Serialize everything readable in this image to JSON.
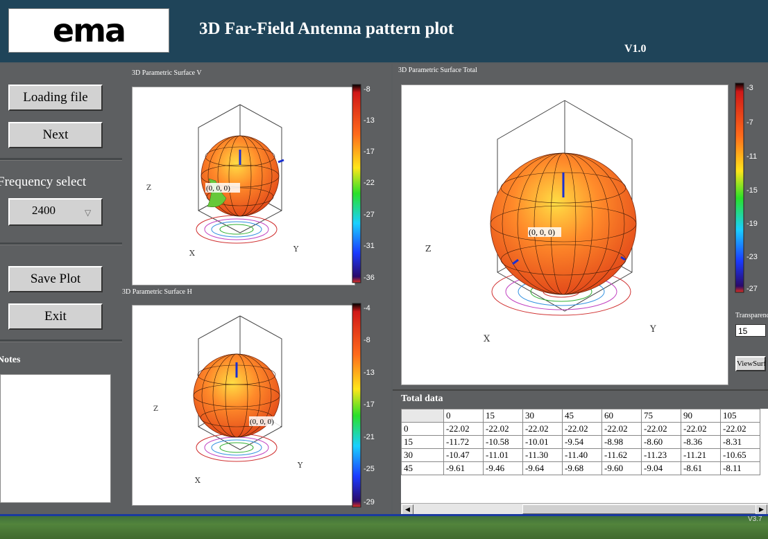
{
  "header": {
    "logo_text": "ema",
    "title": "3D Far-Field Antenna pattern plot",
    "version": "V1.0"
  },
  "left_panel": {
    "loading_button": "Loading file",
    "next_button": "Next",
    "frequency_label": "Frequency select",
    "frequency_value": "2400",
    "save_button": "Save Plot",
    "exit_button": "Exit",
    "notes_label": "Notes"
  },
  "plots": {
    "v": {
      "title": "3D Parametric Surface V",
      "origin_label": "(0, 0, 0)",
      "colorbar_ticks": [
        "-8",
        "-13",
        "-17",
        "-22",
        "-27",
        "-31",
        "-36"
      ]
    },
    "h": {
      "title": "3D Parametric Surface H",
      "origin_label": "(0, 0, 0)",
      "colorbar_ticks": [
        "-4",
        "-8",
        "-13",
        "-17",
        "-21",
        "-25",
        "-29"
      ]
    },
    "total": {
      "title": "3D Parametric Surface Total",
      "origin_label": "(0, 0, 0)",
      "colorbar_ticks": [
        "-3",
        "-7",
        "-11",
        "-15",
        "-19",
        "-23",
        "-27"
      ]
    },
    "axis_labels": {
      "x": "X",
      "y": "Y",
      "z": "Z"
    }
  },
  "controls": {
    "transparency_label": "Transparency",
    "transparency_value": "15",
    "view_button": "ViewSurf"
  },
  "total_data": {
    "label": "Total data",
    "columns": [
      "0",
      "15",
      "30",
      "45",
      "60",
      "75",
      "90",
      "105"
    ],
    "rows": [
      {
        "angle": "0",
        "values": [
          "-22.02",
          "-22.02",
          "-22.02",
          "-22.02",
          "-22.02",
          "-22.02",
          "-22.02",
          "-22.02"
        ]
      },
      {
        "angle": "15",
        "values": [
          "-11.72",
          "-10.58",
          "-10.01",
          "-9.54",
          "-8.98",
          "-8.60",
          "-8.36",
          "-8.31"
        ]
      },
      {
        "angle": "30",
        "values": [
          "-10.47",
          "-11.01",
          "-11.30",
          "-11.40",
          "-11.62",
          "-11.23",
          "-11.21",
          "-10.65"
        ]
      },
      {
        "angle": "45",
        "values": [
          "-9.61",
          "-9.46",
          "-9.64",
          "-9.68",
          "-9.60",
          "-9.04",
          "-8.61",
          "-8.11"
        ]
      }
    ]
  },
  "taskbar": {
    "version": "V3.7"
  }
}
